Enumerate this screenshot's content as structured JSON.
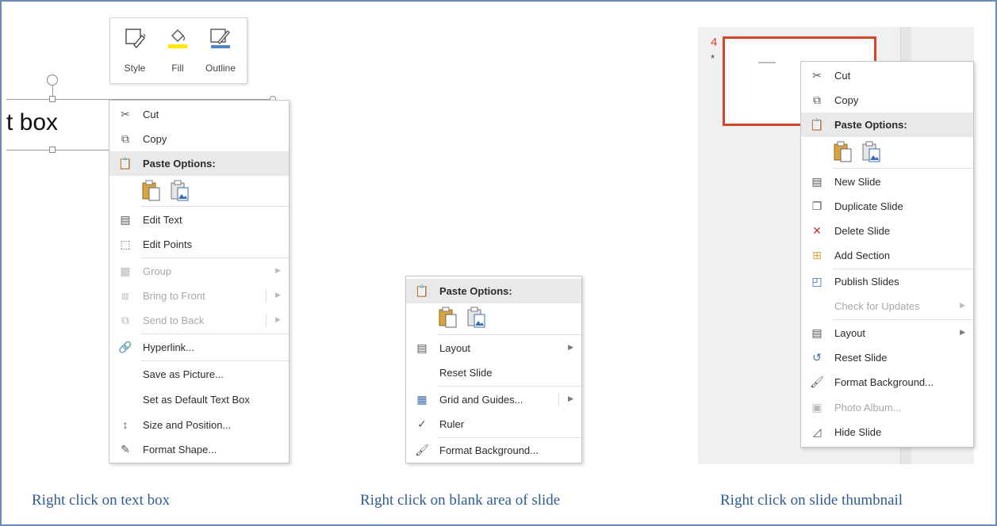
{
  "mini_toolbar": {
    "buttons": [
      {
        "label": "Style",
        "icon": "shape-style-icon"
      },
      {
        "label": "Fill",
        "icon": "paint-bucket-icon"
      },
      {
        "label": "Outline",
        "icon": "pen-outline-icon"
      }
    ]
  },
  "text_box": {
    "text": "t box"
  },
  "menu_textbox": {
    "cut": "Cut",
    "copy": "Copy",
    "paste_options": "Paste Options:",
    "edit_text": "Edit Text",
    "edit_points": "Edit Points",
    "group": "Group",
    "bring_to_front": "Bring to Front",
    "send_to_back": "Send to Back",
    "hyperlink": "Hyperlink...",
    "save_as_picture": "Save as Picture...",
    "set_default": "Set as Default Text Box",
    "size_position": "Size and Position...",
    "format_shape": "Format Shape..."
  },
  "menu_slide": {
    "paste_options": "Paste Options:",
    "layout": "Layout",
    "reset_slide": "Reset Slide",
    "grid_guides": "Grid and Guides...",
    "ruler": "Ruler",
    "format_background": "Format Background..."
  },
  "thumbnail": {
    "slide_number": "4",
    "star": "*"
  },
  "menu_thumb": {
    "cut": "Cut",
    "copy": "Copy",
    "paste_options": "Paste Options:",
    "new_slide": "New Slide",
    "duplicate_slide": "Duplicate Slide",
    "delete_slide": "Delete Slide",
    "add_section": "Add Section",
    "publish_slides": "Publish Slides",
    "check_updates": "Check for Updates",
    "layout": "Layout",
    "reset_slide": "Reset Slide",
    "format_background": "Format Background...",
    "photo_album": "Photo Album...",
    "hide_slide": "Hide Slide"
  },
  "captions": {
    "textbox": "Right click on text box",
    "blank": "Right click on blank area of slide",
    "thumb": "Right click on slide thumbnail"
  },
  "colors": {
    "caption": "#2f5b93",
    "thumb_border": "#d24726",
    "fill_yellow": "#ffe800",
    "outline_blue": "#4a86c8"
  }
}
